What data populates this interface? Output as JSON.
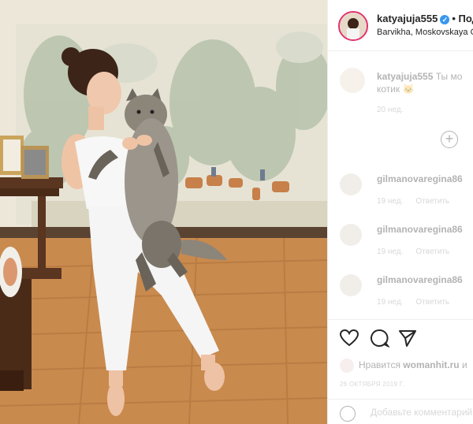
{
  "post": {
    "author": "katyajuja555",
    "follow_label": "• Под",
    "location": "Barvikha, Moskovskaya Ob",
    "verified_mark": "✓"
  },
  "caption": {
    "username": "katyajuja555",
    "text_line1": "Ты мо",
    "text_line2": "котик 🐱",
    "time": "20 нед."
  },
  "load_more_icon": "plus-circle-icon",
  "comments": [
    {
      "username": "gilmanovaregina86",
      "time": "19 нед.",
      "reply": "Ответить"
    },
    {
      "username": "gilmanovaregina86",
      "time": "19 нед.",
      "reply": "Ответить"
    },
    {
      "username": "gilmanovaregina86",
      "time": "19 нед.",
      "reply": "Ответить"
    }
  ],
  "actions": {
    "icons": [
      "heart-icon",
      "comment-icon",
      "share-icon"
    ]
  },
  "likes": {
    "prefix": "Нравится",
    "user": "womanhit.ru",
    "suffix": "и"
  },
  "date": "26 октября 2019 г.",
  "add_comment": {
    "placeholder": "Добавьте комментарий..."
  },
  "colors": {
    "accent": "#3897f0",
    "story_ring": "#e1306c",
    "floor": "#c98a4e",
    "wall": "#ece6d8"
  }
}
